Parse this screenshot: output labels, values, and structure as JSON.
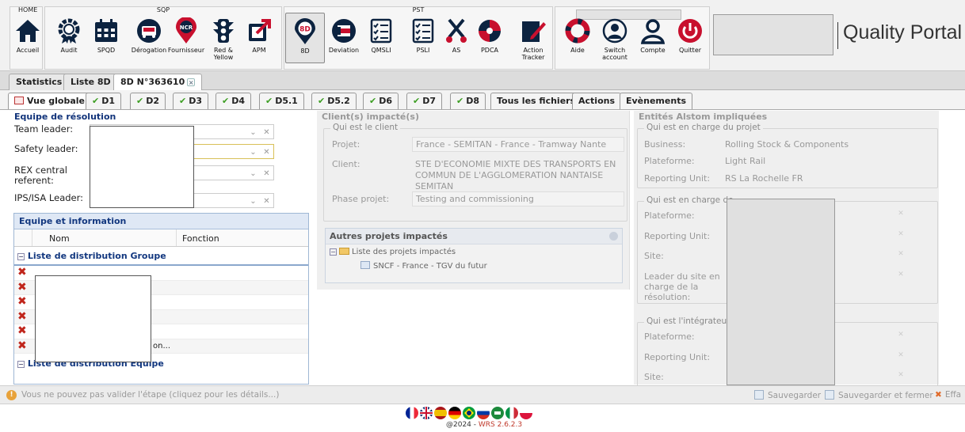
{
  "ribbon": {
    "groups": {
      "home": "HOME",
      "sqp": "SQP",
      "pst": "PST"
    },
    "buttons": [
      {
        "label": "Accueil",
        "icon": "home-icon"
      },
      {
        "label": "Audit",
        "icon": "gear-badge-icon"
      },
      {
        "label": "SPQD",
        "icon": "calendar-icon"
      },
      {
        "label": "Dérogation",
        "icon": "bus-circle-icon"
      },
      {
        "label": "Fournisseur",
        "icon": "ncr-pin-icon"
      },
      {
        "label": "Red & Yellow",
        "icon": "traffic-light-icon"
      },
      {
        "label": "APM",
        "icon": "external-link-icon"
      },
      {
        "label": "8D",
        "icon": "8d-pin-icon"
      },
      {
        "label": "Deviation",
        "icon": "deviation-circle-icon"
      },
      {
        "label": "QMSLI",
        "icon": "checklist-icon"
      },
      {
        "label": "PSLI",
        "icon": "checklist-icon"
      },
      {
        "label": "AS",
        "icon": "scissors-icon"
      },
      {
        "label": "PDCA",
        "icon": "pdca-cycle-icon"
      },
      {
        "label": "Action Tracker",
        "icon": "pencil-icon"
      },
      {
        "label": "Aide",
        "icon": "lifebuoy-icon"
      },
      {
        "label": "Switch account",
        "icon": "switch-user-icon"
      },
      {
        "label": "Compte",
        "icon": "user-icon"
      },
      {
        "label": "Quitter",
        "icon": "power-icon"
      }
    ],
    "portal_title": "Quality Portal"
  },
  "tabs": [
    {
      "label": "Statistics"
    },
    {
      "label": "Liste 8D"
    },
    {
      "label": "8D N°363610"
    }
  ],
  "subtabs": [
    {
      "label": "Vue globale"
    },
    {
      "label": "D1"
    },
    {
      "label": "D2"
    },
    {
      "label": "D3"
    },
    {
      "label": "D4"
    },
    {
      "label": "D5.1"
    },
    {
      "label": "D5.2"
    },
    {
      "label": "D6"
    },
    {
      "label": "D7"
    },
    {
      "label": "D8"
    },
    {
      "label": "Tous les fichiers"
    },
    {
      "label": "Actions"
    },
    {
      "label": "Evènements"
    }
  ],
  "left": {
    "title": "Equipe de résolution",
    "fields": [
      {
        "label": "Team leader:"
      },
      {
        "label": "Safety leader:"
      },
      {
        "label": "REX central referent:"
      },
      {
        "label": "IPS/ISA Leader:"
      }
    ],
    "team": {
      "title": "Equipe et information",
      "columns": [
        "Nom",
        "Fonction"
      ],
      "group_title": "Liste de distribution Groupe",
      "row_count_visible": 6,
      "last_row_text": "on...",
      "footer_group": "Liste de distribution Equipe"
    }
  },
  "clients": {
    "title": "Client(s) impacté(s)",
    "legend": "Qui est le client",
    "projet_label": "Projet:",
    "projet_value": "France - SEMITAN - France - Tramway Nante",
    "client_label": "Client:",
    "client_value": "STE D'ECONOMIE MIXTE DES TRANSPORTS EN COMMUN DE L'AGGLOMERATION NANTAISE SEMITAN",
    "phase_label": "Phase projet:",
    "phase_value": "Testing and commissioning",
    "autres_title": "Autres projets impactés",
    "tree_root": "Liste des projets impactés",
    "tree_child": "SNCF - France - TGV du futur"
  },
  "entites": {
    "title": "Entités Alstom impliquées",
    "projet_legend": "Qui est en charge du projet",
    "business_label": "Business:",
    "business_value": "Rolling Stock & Components",
    "plateforme_label": "Plateforme:",
    "plateforme_value": "Light Rail",
    "reporting_label": "Reporting Unit:",
    "reporting_value": "RS La Rochelle FR",
    "resolution_legend": "Qui est en charge de",
    "r_plateforme": "Plateforme:",
    "r_reporting": "Reporting Unit:",
    "r_site": "Site:",
    "r_leader": "Leader du site en charge de la résolution:",
    "integrateur_legend": "Qui est l'intégrateur / ",
    "i_plateforme": "Plateforme:",
    "i_reporting": "Reporting Unit:",
    "i_site": "Site:"
  },
  "status": {
    "warning": "Vous ne pouvez pas valider l'étape (cliquez pour les détails...)",
    "save": "Sauvegarder",
    "save_close": "Sauvegarder et fermer",
    "delete": "Effa"
  },
  "footer": {
    "version_prefix": "@2024 - ",
    "version": "WRS 2.6.2.3"
  },
  "colors": {
    "accent_red": "#c8102e",
    "check_green": "#3c9e22",
    "header_blue": "#11337a"
  }
}
